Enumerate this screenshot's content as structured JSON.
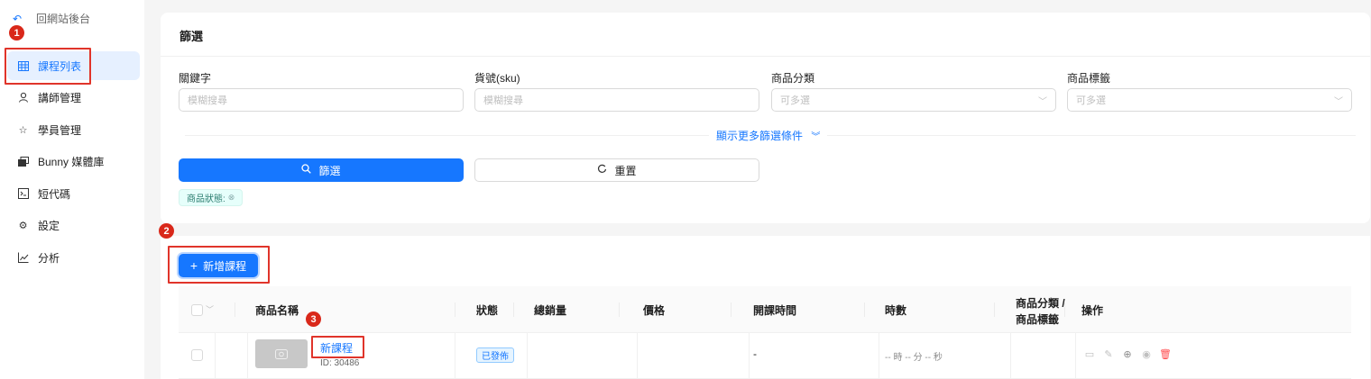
{
  "sidebar": {
    "back_label": "回網站後台",
    "items": [
      {
        "label": "課程列表",
        "icon": "table-icon",
        "active": true
      },
      {
        "label": "講師管理",
        "icon": "user-icon"
      },
      {
        "label": "學員管理",
        "icon": "student-icon"
      },
      {
        "label": "Bunny 媒體庫",
        "icon": "media-library-icon"
      },
      {
        "label": "短代碼",
        "icon": "code-icon"
      },
      {
        "label": "設定",
        "icon": "gear-icon"
      },
      {
        "label": "分析",
        "icon": "line-chart-icon"
      }
    ]
  },
  "annotations": {
    "m1": "1",
    "m2": "2",
    "m3": "3"
  },
  "filter": {
    "title": "篩選",
    "fields": [
      {
        "label": "關鍵字",
        "placeholder": "模糊搜尋"
      },
      {
        "label": "貨號(sku)",
        "placeholder": "模糊搜尋"
      },
      {
        "label": "商品分類",
        "placeholder": "可多選"
      },
      {
        "label": "商品標籤",
        "placeholder": "可多選"
      }
    ],
    "more_label": "顯示更多篩選條件",
    "filter_button": "篩選",
    "reset_button": "重置",
    "status_tag": "商品狀態:"
  },
  "list": {
    "add_button": "新增課程",
    "columns": [
      "商品名稱",
      "狀態",
      "總銷量",
      "價格",
      "開課時間",
      "時數",
      "商品分類 /",
      "商品標籤",
      "操作"
    ],
    "rows": [
      {
        "name": "新課程",
        "id": "ID: 30486",
        "status": "已發佈",
        "sales": "",
        "price": "",
        "start": "-",
        "duration": "-- 時 -- 分 -- 秒"
      }
    ]
  },
  "colors": {
    "primary": "#1677ff",
    "annotation": "#d9281a",
    "danger": "#ff4d4f"
  }
}
